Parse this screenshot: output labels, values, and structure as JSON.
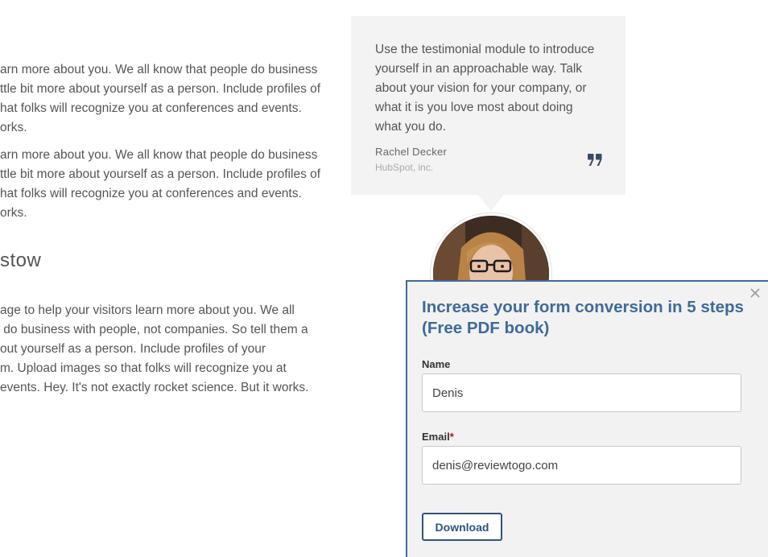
{
  "left_column": {
    "paragraph_1": "arn more about you. We all know that people do business\nttle bit more about yourself as a person. Include profiles of\nhat folks will recognize you at conferences and events.\norks.",
    "paragraph_2": "arn more about you. We all know that people do business\nttle bit more about yourself as a person. Include profiles of\nhat folks will recognize you at conferences and events.\norks.",
    "section_heading": "stow",
    "paragraph_3": "age to help your visitors learn more about you. We all\n do business with people, not companies. So tell them a\nout yourself as a person. Include profiles of your\nm. Upload images so that folks will recognize you at\nevents. Hey. It's not exactly rocket science. But it works."
  },
  "testimonial": {
    "quote": "Use the testimonial module to introduce\nyourself in an approachable way. Talk\nabout your vision for your company, or\nwhat it is you love most about doing\nwhat you do.",
    "author": "Rachel Decker",
    "company": "HubSpot, inc.",
    "quote_icon": "quote-icon",
    "avatar_icon": "person-photo"
  },
  "popup": {
    "title": "Increase your form conversion in 5 steps (Free PDF book)",
    "close_icon": "close-icon",
    "name_label": "Name",
    "name_value": "Denis",
    "email_label": "Email",
    "email_required_mark": "*",
    "email_value": "denis@reviewtogo.com",
    "download_label": "Download"
  },
  "colors": {
    "accent_blue": "#3f6a9a",
    "button_blue": "#2f5480",
    "card_bg": "#f3f3f3",
    "required_red": "#d10000"
  }
}
